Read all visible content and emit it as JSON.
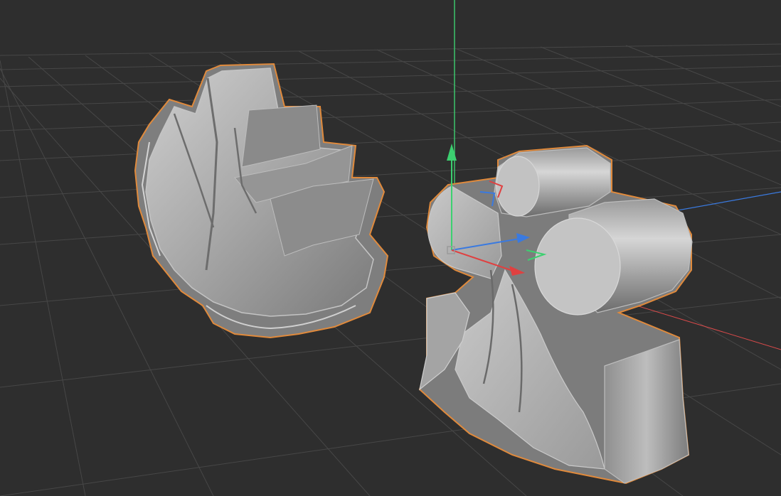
{
  "viewport": {
    "background_color": "#2e2e2e",
    "grid_color": "#4a4a4a",
    "selection_outline_color": "#e08a3c",
    "mesh_color": "#a9a9a9"
  },
  "axes": {
    "x_color": "#e04040",
    "y_color": "#3cd070",
    "z_color": "#3a7ae0"
  },
  "objects": [
    {
      "name": "leaf-object",
      "selected": true
    },
    {
      "name": "club-object",
      "selected": true
    }
  ],
  "gizmo": {
    "handles": [
      "y-axis-arrow",
      "z-axis-arrow",
      "x-axis-arrow",
      "xy-plane-handle",
      "yz-plane-handle",
      "xz-plane-handle"
    ]
  }
}
